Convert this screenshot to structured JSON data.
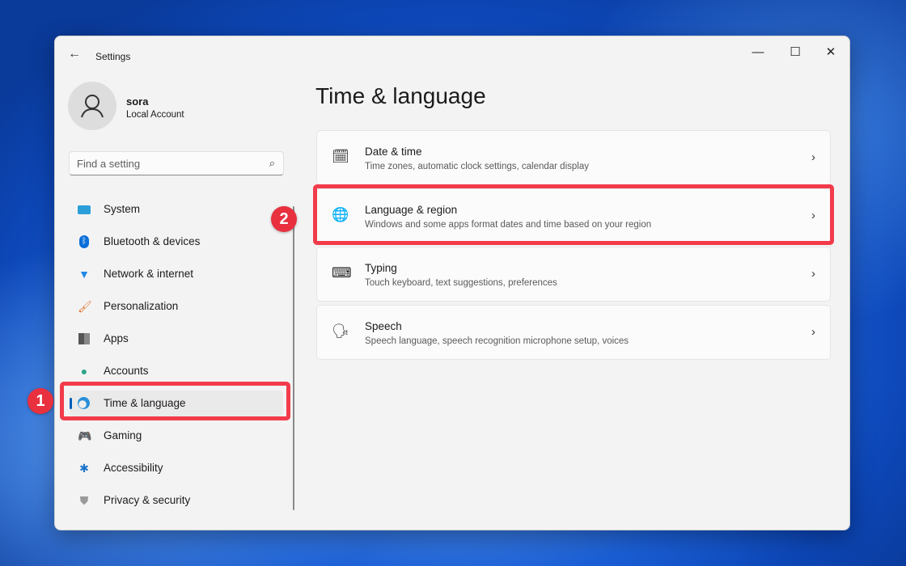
{
  "window": {
    "title": "Settings",
    "controls": {
      "minimize": "—",
      "maximize": "☐",
      "close": "✕"
    },
    "back": "←"
  },
  "user": {
    "name": "sora",
    "account_type": "Local Account"
  },
  "search": {
    "placeholder": "Find a setting",
    "icon": "⌕"
  },
  "nav": [
    {
      "label": "System",
      "icon": "monitor-icon"
    },
    {
      "label": "Bluetooth & devices",
      "icon": "bluetooth-icon"
    },
    {
      "label": "Network & internet",
      "icon": "wifi-icon"
    },
    {
      "label": "Personalization",
      "icon": "brush-icon"
    },
    {
      "label": "Apps",
      "icon": "apps-icon"
    },
    {
      "label": "Accounts",
      "icon": "person-icon"
    },
    {
      "label": "Time & language",
      "icon": "globe-clock-icon",
      "selected": true
    },
    {
      "label": "Gaming",
      "icon": "gamepad-icon"
    },
    {
      "label": "Accessibility",
      "icon": "accessibility-icon"
    },
    {
      "label": "Privacy & security",
      "icon": "shield-icon"
    }
  ],
  "main": {
    "title": "Time & language",
    "cards": [
      {
        "title": "Date & time",
        "subtitle": "Time zones, automatic clock settings, calendar display",
        "icon": "calendar-clock-icon"
      },
      {
        "title": "Language & region",
        "subtitle": "Windows and some apps format dates and time based on your region",
        "icon": "language-icon"
      },
      {
        "title": "Typing",
        "subtitle": "Touch keyboard, text suggestions, preferences",
        "icon": "keyboard-icon"
      },
      {
        "title": "Speech",
        "subtitle": "Speech language, speech recognition microphone setup, voices",
        "icon": "speech-icon"
      }
    ]
  },
  "annotations": {
    "step1": "1",
    "step2": "2",
    "color": "#f23b4a"
  }
}
